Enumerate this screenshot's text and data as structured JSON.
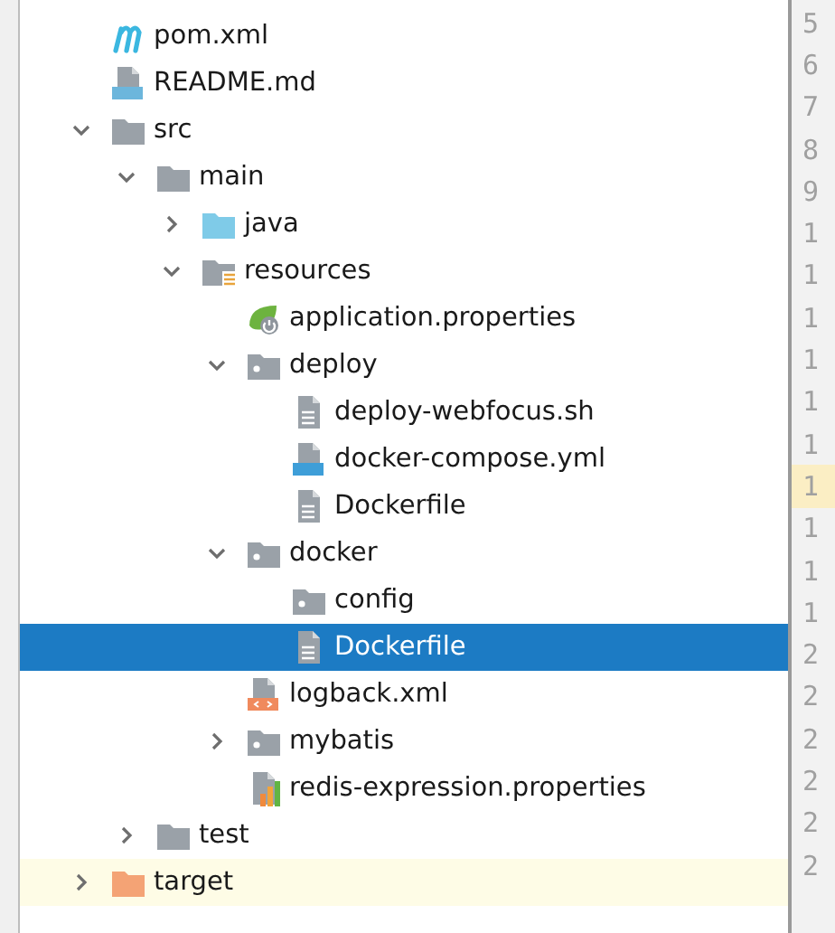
{
  "tree": [
    {
      "label": "pom.xml",
      "kind": "maven",
      "selected": false,
      "highlighted": false
    },
    {
      "label": "README.md",
      "kind": "markdown",
      "selected": false,
      "highlighted": false
    },
    {
      "label": "src",
      "kind": "folder",
      "expanded": true,
      "selected": false,
      "highlighted": false,
      "children": [
        {
          "label": "main",
          "kind": "folder",
          "expanded": true,
          "selected": false,
          "highlighted": false,
          "children": [
            {
              "label": "java",
              "kind": "source-folder",
              "expanded": false,
              "selected": false,
              "highlighted": false
            },
            {
              "label": "resources",
              "kind": "resource-folder",
              "expanded": true,
              "selected": false,
              "highlighted": false,
              "children": [
                {
                  "label": "application.properties",
                  "kind": "spring",
                  "selected": false,
                  "highlighted": false
                },
                {
                  "label": "deploy",
                  "kind": "package",
                  "expanded": true,
                  "selected": false,
                  "highlighted": false,
                  "children": [
                    {
                      "label": "deploy-webfocus.sh",
                      "kind": "text",
                      "selected": false,
                      "highlighted": false
                    },
                    {
                      "label": "docker-compose.yml",
                      "kind": "compose",
                      "selected": false,
                      "highlighted": false
                    },
                    {
                      "label": "Dockerfile",
                      "kind": "text",
                      "selected": false,
                      "highlighted": false
                    }
                  ]
                },
                {
                  "label": "docker",
                  "kind": "package",
                  "expanded": true,
                  "selected": false,
                  "highlighted": false,
                  "children": [
                    {
                      "label": "config",
                      "kind": "package",
                      "selected": false,
                      "highlighted": false
                    },
                    {
                      "label": "Dockerfile",
                      "kind": "text",
                      "selected": true,
                      "highlighted": false
                    }
                  ]
                },
                {
                  "label": "logback.xml",
                  "kind": "xml",
                  "selected": false,
                  "highlighted": false
                },
                {
                  "label": "mybatis",
                  "kind": "package",
                  "expanded": false,
                  "selected": false,
                  "highlighted": false
                },
                {
                  "label": "redis-expression.properties",
                  "kind": "properties",
                  "selected": false,
                  "highlighted": false
                }
              ]
            }
          ]
        },
        {
          "label": "test",
          "kind": "folder",
          "expanded": false,
          "selected": false,
          "highlighted": false
        }
      ]
    },
    {
      "label": "target",
      "kind": "excluded-folder",
      "expanded": false,
      "selected": false,
      "highlighted": true
    }
  ],
  "gutter": [
    {
      "number": "5",
      "current": false
    },
    {
      "number": "6",
      "current": false
    },
    {
      "number": "7",
      "current": false
    },
    {
      "number": "8",
      "current": false
    },
    {
      "number": "9",
      "current": false
    },
    {
      "number": "1",
      "current": false
    },
    {
      "number": "1",
      "current": false
    },
    {
      "number": "1",
      "current": false
    },
    {
      "number": "1",
      "current": false
    },
    {
      "number": "1",
      "current": false
    },
    {
      "number": "1",
      "current": false
    },
    {
      "number": "1",
      "current": true
    },
    {
      "number": "1",
      "current": false
    },
    {
      "number": "1",
      "current": false
    },
    {
      "number": "1",
      "current": false
    },
    {
      "number": "2",
      "current": false
    },
    {
      "number": "2",
      "current": false
    },
    {
      "number": "2",
      "current": false
    },
    {
      "number": "2",
      "current": false
    },
    {
      "number": "2",
      "current": false
    },
    {
      "number": "2",
      "current": false
    }
  ]
}
